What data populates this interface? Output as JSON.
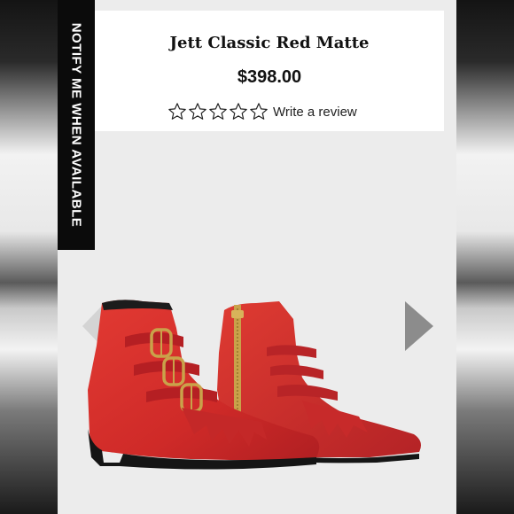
{
  "product": {
    "title": "Jett Classic Red Matte",
    "price": "$398.00",
    "rating_stars": 0,
    "rating_max": 5,
    "write_review_label": "Write a review"
  },
  "notify_bar": {
    "label": "NOTIFY ME WHEN AVAILABLE"
  },
  "gallery": {
    "prev_icon": "chevron-left-icon",
    "next_icon": "chevron-right-icon",
    "image_subject": "red leather ankle boots with gold buckles"
  },
  "colors": {
    "boot_red": "#d3262a",
    "buckle_gold": "#c9a24a",
    "page_background": "#ececec",
    "notify_bar": "#0b0b0b"
  }
}
